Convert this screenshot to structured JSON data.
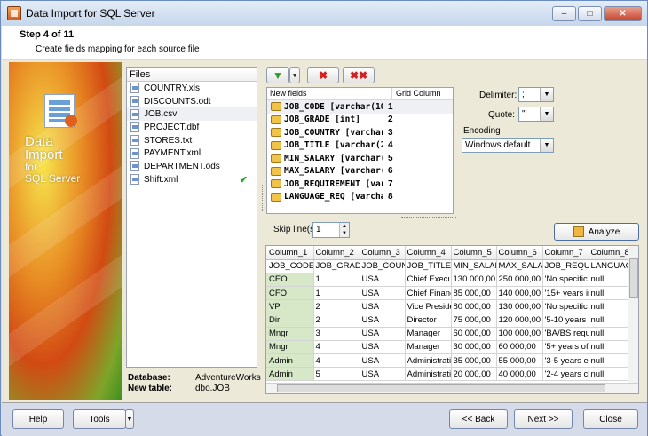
{
  "window": {
    "title": "Data Import for SQL Server"
  },
  "header": {
    "step": "Step 4 of 11",
    "subtitle": "Create fields mapping for each source file"
  },
  "banner": {
    "line1": "Data",
    "line2": "Import",
    "line3": "for",
    "line4": "SQL Server"
  },
  "files": {
    "header": "Files",
    "items": [
      "COUNTRY.xls",
      "DISCOUNTS.odt",
      "JOB.csv",
      "PROJECT.dbf",
      "STORES.txt",
      "PAYMENT.xml",
      "DEPARTMENT.ods",
      "Shift.xml"
    ],
    "selected_index": 2,
    "checked_index": 7
  },
  "db": {
    "database_label": "Database:",
    "database_value": "AdventureWorks",
    "table_label": "New table:",
    "table_value": "dbo.JOB"
  },
  "fields": {
    "col_new": "New fields",
    "col_grid": "Grid Column",
    "rows": [
      {
        "name": "JOB_CODE [varchar(10)",
        "col": "1"
      },
      {
        "name": "JOB_GRADE [int]",
        "col": "2"
      },
      {
        "name": "JOB_COUNTRY [varchar",
        "col": "3"
      },
      {
        "name": "JOB_TITLE [varchar(24)",
        "col": "4"
      },
      {
        "name": "MIN_SALARY [varchar(",
        "col": "5"
      },
      {
        "name": "MAX_SALARY [varchar(",
        "col": "6"
      },
      {
        "name": "JOB_REQUIREMENT [var",
        "col": "7"
      },
      {
        "name": "LANGUAGE_REQ [varcha",
        "col": "8"
      }
    ]
  },
  "options": {
    "delimiter_label": "Delimiter:",
    "delimiter_value": ";",
    "quote_label": "Quote:",
    "quote_value": "\"",
    "encoding_label": "Encoding",
    "encoding_value": "Windows default"
  },
  "skip": {
    "label": "Skip line(s)",
    "value": "1"
  },
  "analyze_label": "Analyze",
  "grid": {
    "columns": [
      "Column_1",
      "Column_2",
      "Column_3",
      "Column_4",
      "Column_5",
      "Column_6",
      "Column_7",
      "Column_8"
    ],
    "rows": [
      [
        "JOB_CODE",
        "JOB_GRADI",
        "JOB_COUNT",
        "JOB_TITLE",
        "MIN_SALAF",
        "MAX_SALAF",
        "JOB_REQUI",
        "LANGUAG"
      ],
      [
        "CEO",
        "1",
        "USA",
        "Chief Execut",
        "130 000,00",
        "250 000,00",
        "'No specific",
        "null"
      ],
      [
        "CFO",
        "1",
        "USA",
        "Chief Financ",
        "85 000,00",
        "140 000,00",
        "'15+ years in",
        "null"
      ],
      [
        "VP",
        "2",
        "USA",
        "Vice Preside",
        "80 000,00",
        "130 000,00",
        "'No specific",
        "null"
      ],
      [
        "Dir",
        "2",
        "USA",
        "Director",
        "75 000,00",
        "120 000,00",
        "'5-10 years a",
        "null"
      ],
      [
        "Mngr",
        "3",
        "USA",
        "Manager",
        "60 000,00",
        "100 000,00",
        "'BA/BS requ",
        "null"
      ],
      [
        "Mngr",
        "4",
        "USA",
        "Manager",
        "30 000,00",
        "60 000,00",
        "'5+ years offi",
        "null"
      ],
      [
        "Admin",
        "4",
        "USA",
        "Administrativ",
        "35 000,00",
        "55 000,00",
        "'3-5 years ex",
        "null"
      ],
      [
        "Admin",
        "5",
        "USA",
        "Administrativ",
        "20 000,00",
        "40 000,00",
        "'2-4 years cl",
        "null"
      ]
    ]
  },
  "footer": {
    "help": "Help",
    "tools": "Tools",
    "back": "<< Back",
    "next": "Next >>",
    "close": "Close"
  }
}
